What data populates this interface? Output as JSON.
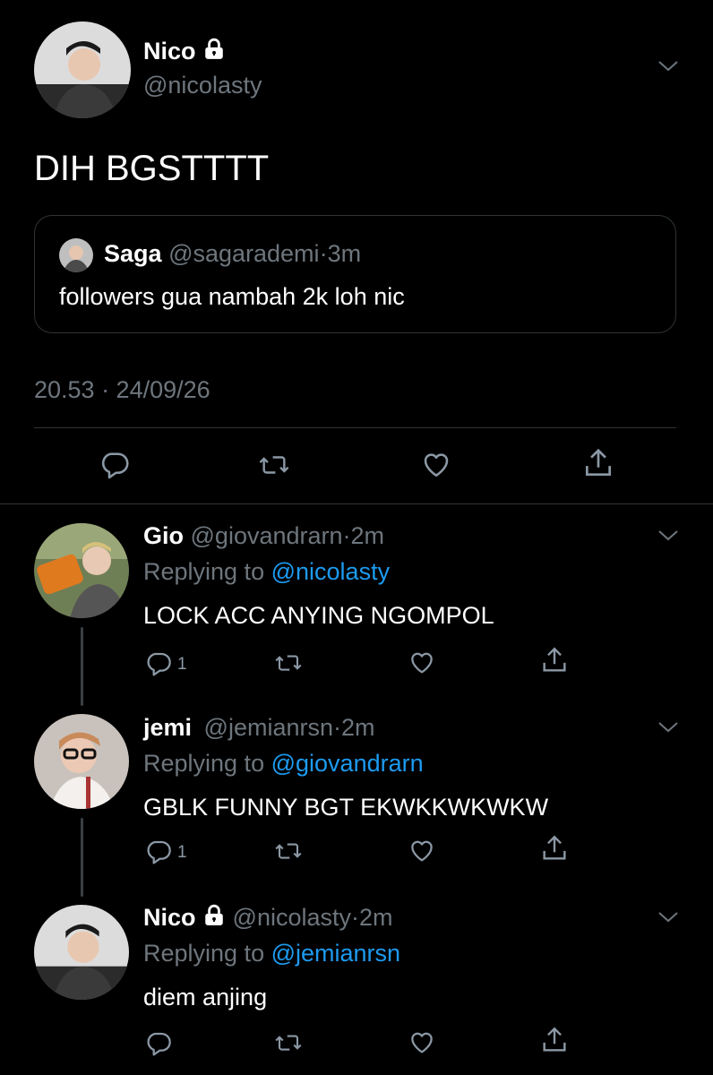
{
  "main_tweet": {
    "name": "Nico",
    "handle": "@nicolasty",
    "text": "DIH BGSTTTT",
    "quote": {
      "name": "Saga",
      "handle": "@sagarademi",
      "separator": "·",
      "time": "3m",
      "text": "followers gua nambah 2k loh nic"
    },
    "timestamp": "20.53 · 24/09/26"
  },
  "replies": [
    {
      "name": "Gio",
      "handle": "@giovandrarn",
      "separator": "·",
      "time": "2m",
      "replying_prefix": "Replying to",
      "replying_to": "@nicolasty",
      "text": "LOCK ACC ANYING NGOMPOL",
      "reply_count": "1"
    },
    {
      "name": "jemi",
      "handle": "@jemianrsn",
      "separator": "·",
      "time": "2m",
      "replying_prefix": "Replying to",
      "replying_to": "@giovandrarn",
      "text": "GBLK FUNNY BGT EKWKKWKWKW",
      "reply_count": "1"
    },
    {
      "name": "Nico",
      "handle": "@nicolasty",
      "separator": "·",
      "time": "2m",
      "replying_prefix": "Replying to",
      "replying_to": "@jemianrsn",
      "text": "diem anjing",
      "reply_count": ""
    }
  ],
  "icons": [
    "reply-icon",
    "retweet-icon",
    "like-icon",
    "share-icon",
    "lock-icon",
    "chevron-down-icon"
  ],
  "colors": {
    "background": "#000000",
    "link": "#1d9bf0",
    "muted": "#6e767d"
  }
}
